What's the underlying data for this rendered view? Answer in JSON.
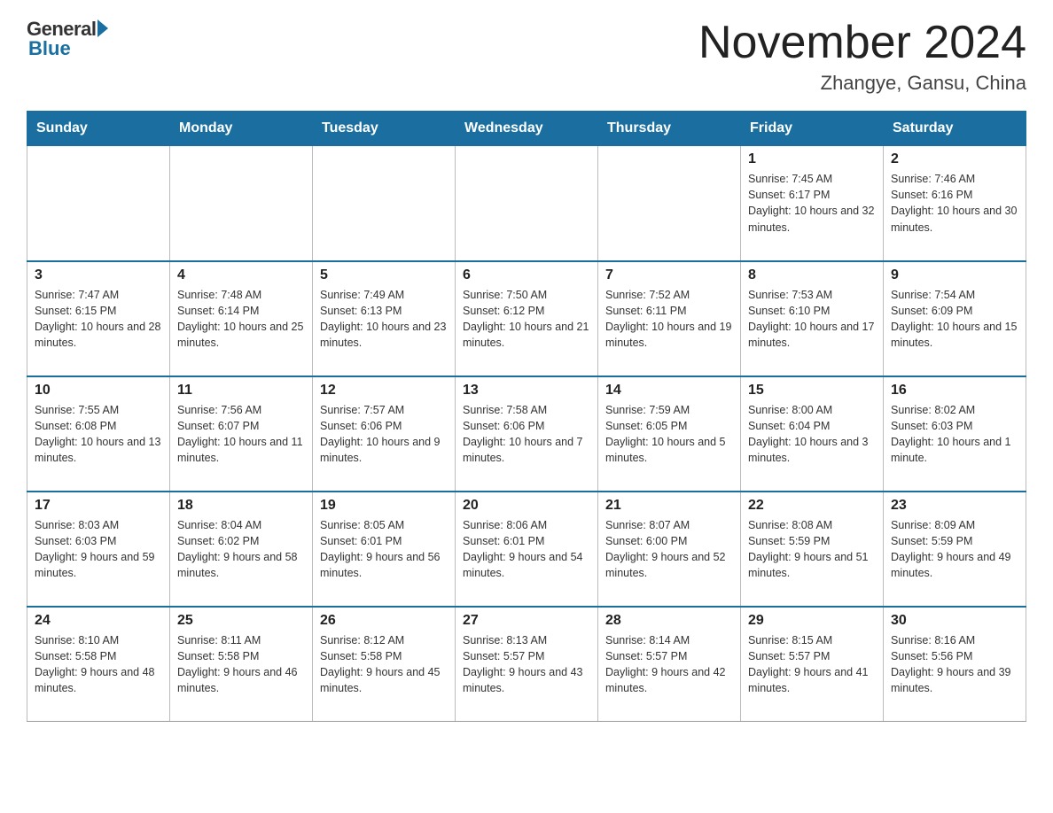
{
  "header": {
    "logo_general": "General",
    "logo_blue": "Blue",
    "month_title": "November 2024",
    "location": "Zhangye, Gansu, China"
  },
  "weekdays": [
    "Sunday",
    "Monday",
    "Tuesday",
    "Wednesday",
    "Thursday",
    "Friday",
    "Saturday"
  ],
  "weeks": [
    [
      {
        "day": "",
        "sunrise": "",
        "sunset": "",
        "daylight": ""
      },
      {
        "day": "",
        "sunrise": "",
        "sunset": "",
        "daylight": ""
      },
      {
        "day": "",
        "sunrise": "",
        "sunset": "",
        "daylight": ""
      },
      {
        "day": "",
        "sunrise": "",
        "sunset": "",
        "daylight": ""
      },
      {
        "day": "",
        "sunrise": "",
        "sunset": "",
        "daylight": ""
      },
      {
        "day": "1",
        "sunrise": "Sunrise: 7:45 AM",
        "sunset": "Sunset: 6:17 PM",
        "daylight": "Daylight: 10 hours and 32 minutes."
      },
      {
        "day": "2",
        "sunrise": "Sunrise: 7:46 AM",
        "sunset": "Sunset: 6:16 PM",
        "daylight": "Daylight: 10 hours and 30 minutes."
      }
    ],
    [
      {
        "day": "3",
        "sunrise": "Sunrise: 7:47 AM",
        "sunset": "Sunset: 6:15 PM",
        "daylight": "Daylight: 10 hours and 28 minutes."
      },
      {
        "day": "4",
        "sunrise": "Sunrise: 7:48 AM",
        "sunset": "Sunset: 6:14 PM",
        "daylight": "Daylight: 10 hours and 25 minutes."
      },
      {
        "day": "5",
        "sunrise": "Sunrise: 7:49 AM",
        "sunset": "Sunset: 6:13 PM",
        "daylight": "Daylight: 10 hours and 23 minutes."
      },
      {
        "day": "6",
        "sunrise": "Sunrise: 7:50 AM",
        "sunset": "Sunset: 6:12 PM",
        "daylight": "Daylight: 10 hours and 21 minutes."
      },
      {
        "day": "7",
        "sunrise": "Sunrise: 7:52 AM",
        "sunset": "Sunset: 6:11 PM",
        "daylight": "Daylight: 10 hours and 19 minutes."
      },
      {
        "day": "8",
        "sunrise": "Sunrise: 7:53 AM",
        "sunset": "Sunset: 6:10 PM",
        "daylight": "Daylight: 10 hours and 17 minutes."
      },
      {
        "day": "9",
        "sunrise": "Sunrise: 7:54 AM",
        "sunset": "Sunset: 6:09 PM",
        "daylight": "Daylight: 10 hours and 15 minutes."
      }
    ],
    [
      {
        "day": "10",
        "sunrise": "Sunrise: 7:55 AM",
        "sunset": "Sunset: 6:08 PM",
        "daylight": "Daylight: 10 hours and 13 minutes."
      },
      {
        "day": "11",
        "sunrise": "Sunrise: 7:56 AM",
        "sunset": "Sunset: 6:07 PM",
        "daylight": "Daylight: 10 hours and 11 minutes."
      },
      {
        "day": "12",
        "sunrise": "Sunrise: 7:57 AM",
        "sunset": "Sunset: 6:06 PM",
        "daylight": "Daylight: 10 hours and 9 minutes."
      },
      {
        "day": "13",
        "sunrise": "Sunrise: 7:58 AM",
        "sunset": "Sunset: 6:06 PM",
        "daylight": "Daylight: 10 hours and 7 minutes."
      },
      {
        "day": "14",
        "sunrise": "Sunrise: 7:59 AM",
        "sunset": "Sunset: 6:05 PM",
        "daylight": "Daylight: 10 hours and 5 minutes."
      },
      {
        "day": "15",
        "sunrise": "Sunrise: 8:00 AM",
        "sunset": "Sunset: 6:04 PM",
        "daylight": "Daylight: 10 hours and 3 minutes."
      },
      {
        "day": "16",
        "sunrise": "Sunrise: 8:02 AM",
        "sunset": "Sunset: 6:03 PM",
        "daylight": "Daylight: 10 hours and 1 minute."
      }
    ],
    [
      {
        "day": "17",
        "sunrise": "Sunrise: 8:03 AM",
        "sunset": "Sunset: 6:03 PM",
        "daylight": "Daylight: 9 hours and 59 minutes."
      },
      {
        "day": "18",
        "sunrise": "Sunrise: 8:04 AM",
        "sunset": "Sunset: 6:02 PM",
        "daylight": "Daylight: 9 hours and 58 minutes."
      },
      {
        "day": "19",
        "sunrise": "Sunrise: 8:05 AM",
        "sunset": "Sunset: 6:01 PM",
        "daylight": "Daylight: 9 hours and 56 minutes."
      },
      {
        "day": "20",
        "sunrise": "Sunrise: 8:06 AM",
        "sunset": "Sunset: 6:01 PM",
        "daylight": "Daylight: 9 hours and 54 minutes."
      },
      {
        "day": "21",
        "sunrise": "Sunrise: 8:07 AM",
        "sunset": "Sunset: 6:00 PM",
        "daylight": "Daylight: 9 hours and 52 minutes."
      },
      {
        "day": "22",
        "sunrise": "Sunrise: 8:08 AM",
        "sunset": "Sunset: 5:59 PM",
        "daylight": "Daylight: 9 hours and 51 minutes."
      },
      {
        "day": "23",
        "sunrise": "Sunrise: 8:09 AM",
        "sunset": "Sunset: 5:59 PM",
        "daylight": "Daylight: 9 hours and 49 minutes."
      }
    ],
    [
      {
        "day": "24",
        "sunrise": "Sunrise: 8:10 AM",
        "sunset": "Sunset: 5:58 PM",
        "daylight": "Daylight: 9 hours and 48 minutes."
      },
      {
        "day": "25",
        "sunrise": "Sunrise: 8:11 AM",
        "sunset": "Sunset: 5:58 PM",
        "daylight": "Daylight: 9 hours and 46 minutes."
      },
      {
        "day": "26",
        "sunrise": "Sunrise: 8:12 AM",
        "sunset": "Sunset: 5:58 PM",
        "daylight": "Daylight: 9 hours and 45 minutes."
      },
      {
        "day": "27",
        "sunrise": "Sunrise: 8:13 AM",
        "sunset": "Sunset: 5:57 PM",
        "daylight": "Daylight: 9 hours and 43 minutes."
      },
      {
        "day": "28",
        "sunrise": "Sunrise: 8:14 AM",
        "sunset": "Sunset: 5:57 PM",
        "daylight": "Daylight: 9 hours and 42 minutes."
      },
      {
        "day": "29",
        "sunrise": "Sunrise: 8:15 AM",
        "sunset": "Sunset: 5:57 PM",
        "daylight": "Daylight: 9 hours and 41 minutes."
      },
      {
        "day": "30",
        "sunrise": "Sunrise: 8:16 AM",
        "sunset": "Sunset: 5:56 PM",
        "daylight": "Daylight: 9 hours and 39 minutes."
      }
    ]
  ]
}
